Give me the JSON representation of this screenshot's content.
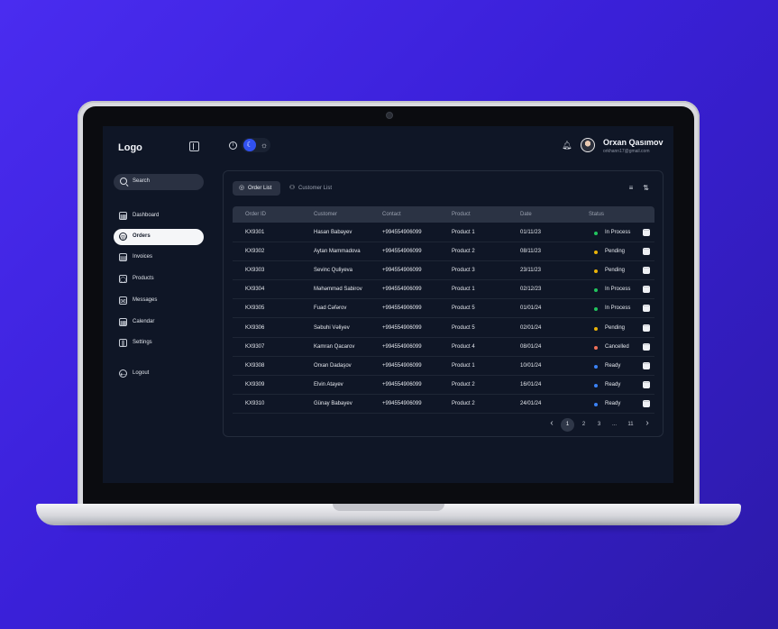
{
  "app": {
    "logo": "Logo"
  },
  "search": {
    "label": "Search"
  },
  "nav": [
    {
      "label": "Dashboard",
      "icon": "dashboard-icon"
    },
    {
      "label": "Orders",
      "icon": "orders-icon",
      "active": true
    },
    {
      "label": "Invoices",
      "icon": "invoice-icon"
    },
    {
      "label": "Products",
      "icon": "products-icon"
    },
    {
      "label": "Messages",
      "icon": "mail-icon"
    },
    {
      "label": "Calendar",
      "icon": "calendar-icon"
    },
    {
      "label": "Settings",
      "icon": "sliders-icon"
    }
  ],
  "logout": {
    "label": "Logout"
  },
  "user": {
    "name": "Orxan Qasımov",
    "email": "orkhann17@gmail.com"
  },
  "tabs": [
    {
      "label": "Order List",
      "icon": "orders-icon",
      "active": true
    },
    {
      "label": "Customer List",
      "icon": "users-icon",
      "active": false
    }
  ],
  "table": {
    "columns": [
      "Order ID",
      "Customer",
      "Contact",
      "Product",
      "Date",
      "Status"
    ],
    "rows": [
      {
        "id": "KX9301",
        "customer": "Hasan Babayev",
        "contact": "+994554906099",
        "product": "Product 1",
        "date": "01/11/23",
        "status": "In Process"
      },
      {
        "id": "KX9302",
        "customer": "Aytan Mammadova",
        "contact": "+994554906099",
        "product": "Product 2",
        "date": "08/11/23",
        "status": "Pending"
      },
      {
        "id": "KX9303",
        "customer": "Sevinc Quliyeva",
        "contact": "+994554906099",
        "product": "Product 3",
        "date": "23/11/23",
        "status": "Pending"
      },
      {
        "id": "KX9304",
        "customer": "Məhəmməd Sabirov",
        "contact": "+994554906099",
        "product": "Product 1",
        "date": "02/12/23",
        "status": "In Process"
      },
      {
        "id": "KX9305",
        "customer": "Fuad Cəfərov",
        "contact": "+994554906099",
        "product": "Product 5",
        "date": "01/01/24",
        "status": "In Process"
      },
      {
        "id": "KX9306",
        "customer": "Səbuhi Vəliyev",
        "contact": "+994554906099",
        "product": "Product 5",
        "date": "02/01/24",
        "status": "Pending"
      },
      {
        "id": "KX9307",
        "customer": "Kamran Qacarov",
        "contact": "+994554906099",
        "product": "Product 4",
        "date": "08/01/24",
        "status": "Cancelled"
      },
      {
        "id": "KX9308",
        "customer": "Orxan Dadaşov",
        "contact": "+994554906099",
        "product": "Product 1",
        "date": "10/01/24",
        "status": "Ready"
      },
      {
        "id": "KX9309",
        "customer": "Elvin Atayev",
        "contact": "+994554906099",
        "product": "Product 2",
        "date": "16/01/24",
        "status": "Ready"
      },
      {
        "id": "KX9310",
        "customer": "Günay Babayev",
        "contact": "+994554906099",
        "product": "Product 2",
        "date": "24/01/24",
        "status": "Ready"
      }
    ]
  },
  "status_colors": {
    "In Process": "#22c55e",
    "Pending": "#eab308",
    "Cancelled": "#f0705a",
    "Ready": "#3b82f6"
  },
  "pagination": {
    "pages": [
      "1",
      "2",
      "3",
      "...",
      "11"
    ],
    "active": "1"
  },
  "colors": {
    "accent": "#3151f0",
    "background": "#0f1626"
  }
}
